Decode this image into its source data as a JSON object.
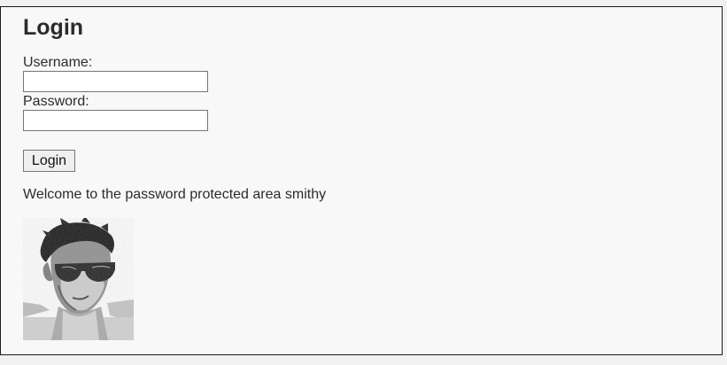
{
  "login": {
    "heading": "Login",
    "username_label": "Username:",
    "username_value": "",
    "password_label": "Password:",
    "password_value": "",
    "submit_label": "Login"
  },
  "welcome_text": "Welcome to the password protected area smithy",
  "profile_image": {
    "alt": "smithy"
  }
}
